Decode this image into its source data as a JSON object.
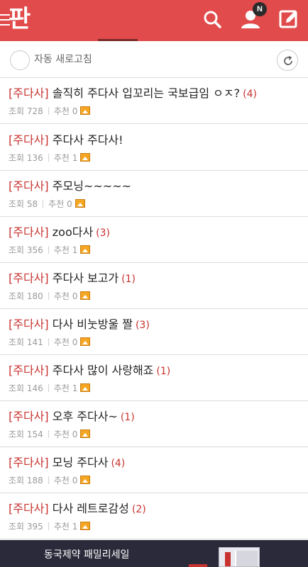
{
  "header": {
    "logo_text": "판",
    "notification_badge": "N",
    "colors": {
      "bar": "#e14b4b",
      "badge": "#2b2b2b"
    },
    "icons": [
      "menu-icon",
      "search-icon",
      "user-icon",
      "write-icon"
    ]
  },
  "refresh": {
    "label": "자동 새로고침"
  },
  "posts": [
    {
      "tag": "[주다사]",
      "title": "솔직히 주다사 입꼬리는 국보급임 ㅇㅈ?",
      "comments": "(4)",
      "views_label": "조회 728",
      "likes_label": "추천 0"
    },
    {
      "tag": "[주다사]",
      "title": "주다사 주다사!",
      "comments": "",
      "views_label": "조회 136",
      "likes_label": "추천 1"
    },
    {
      "tag": "[주다사]",
      "title": "주모닝~~~~~",
      "comments": "",
      "views_label": "조회 58",
      "likes_label": "추천 0"
    },
    {
      "tag": "[주다사]",
      "title": "zoo다사",
      "comments": "(3)",
      "views_label": "조회 356",
      "likes_label": "추천 1"
    },
    {
      "tag": "[주다사]",
      "title": "주다사 보고가",
      "comments": "(1)",
      "views_label": "조회 180",
      "likes_label": "추천 0"
    },
    {
      "tag": "[주다사]",
      "title": "다사 비눗방울 짤",
      "comments": "(3)",
      "views_label": "조회 141",
      "likes_label": "추천 0"
    },
    {
      "tag": "[주다사]",
      "title": "주다사 많이 사랑해죠",
      "comments": "(1)",
      "views_label": "조회 146",
      "likes_label": "추천 1"
    },
    {
      "tag": "[주다사]",
      "title": "오후 주다사~",
      "comments": "(1)",
      "views_label": "조회 154",
      "likes_label": "추천 0"
    },
    {
      "tag": "[주다사]",
      "title": "모닝 주다사",
      "comments": "(4)",
      "views_label": "조회 188",
      "likes_label": "추천 0"
    },
    {
      "tag": "[주다사]",
      "title": "다사 레트로감성",
      "comments": "(2)",
      "views_label": "조회 395",
      "likes_label": "추천 1"
    }
  ],
  "ad": {
    "text": "동국제약 패밀리세일"
  },
  "colors": {
    "accent": "#c8332f",
    "meta": "#9a9a9a",
    "divider": "#dcdcdc"
  }
}
